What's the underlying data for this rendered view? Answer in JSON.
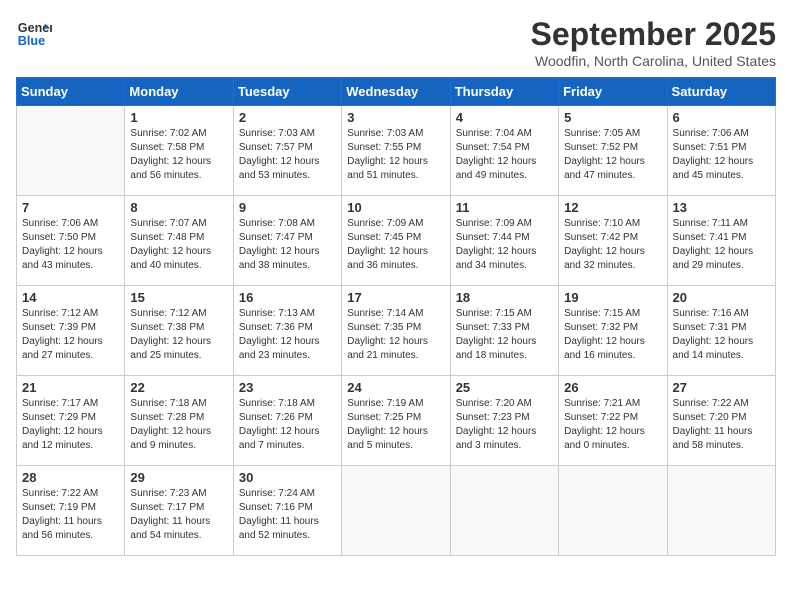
{
  "logo": {
    "line1": "General",
    "line2": "Blue"
  },
  "header": {
    "month_year": "September 2025",
    "location": "Woodfin, North Carolina, United States"
  },
  "days_of_week": [
    "Sunday",
    "Monday",
    "Tuesday",
    "Wednesday",
    "Thursday",
    "Friday",
    "Saturday"
  ],
  "weeks": [
    [
      {
        "day": "",
        "detail": ""
      },
      {
        "day": "1",
        "detail": "Sunrise: 7:02 AM\nSunset: 7:58 PM\nDaylight: 12 hours and 56 minutes."
      },
      {
        "day": "2",
        "detail": "Sunrise: 7:03 AM\nSunset: 7:57 PM\nDaylight: 12 hours and 53 minutes."
      },
      {
        "day": "3",
        "detail": "Sunrise: 7:03 AM\nSunset: 7:55 PM\nDaylight: 12 hours and 51 minutes."
      },
      {
        "day": "4",
        "detail": "Sunrise: 7:04 AM\nSunset: 7:54 PM\nDaylight: 12 hours and 49 minutes."
      },
      {
        "day": "5",
        "detail": "Sunrise: 7:05 AM\nSunset: 7:52 PM\nDaylight: 12 hours and 47 minutes."
      },
      {
        "day": "6",
        "detail": "Sunrise: 7:06 AM\nSunset: 7:51 PM\nDaylight: 12 hours and 45 minutes."
      }
    ],
    [
      {
        "day": "7",
        "detail": "Sunrise: 7:06 AM\nSunset: 7:50 PM\nDaylight: 12 hours and 43 minutes."
      },
      {
        "day": "8",
        "detail": "Sunrise: 7:07 AM\nSunset: 7:48 PM\nDaylight: 12 hours and 40 minutes."
      },
      {
        "day": "9",
        "detail": "Sunrise: 7:08 AM\nSunset: 7:47 PM\nDaylight: 12 hours and 38 minutes."
      },
      {
        "day": "10",
        "detail": "Sunrise: 7:09 AM\nSunset: 7:45 PM\nDaylight: 12 hours and 36 minutes."
      },
      {
        "day": "11",
        "detail": "Sunrise: 7:09 AM\nSunset: 7:44 PM\nDaylight: 12 hours and 34 minutes."
      },
      {
        "day": "12",
        "detail": "Sunrise: 7:10 AM\nSunset: 7:42 PM\nDaylight: 12 hours and 32 minutes."
      },
      {
        "day": "13",
        "detail": "Sunrise: 7:11 AM\nSunset: 7:41 PM\nDaylight: 12 hours and 29 minutes."
      }
    ],
    [
      {
        "day": "14",
        "detail": "Sunrise: 7:12 AM\nSunset: 7:39 PM\nDaylight: 12 hours and 27 minutes."
      },
      {
        "day": "15",
        "detail": "Sunrise: 7:12 AM\nSunset: 7:38 PM\nDaylight: 12 hours and 25 minutes."
      },
      {
        "day": "16",
        "detail": "Sunrise: 7:13 AM\nSunset: 7:36 PM\nDaylight: 12 hours and 23 minutes."
      },
      {
        "day": "17",
        "detail": "Sunrise: 7:14 AM\nSunset: 7:35 PM\nDaylight: 12 hours and 21 minutes."
      },
      {
        "day": "18",
        "detail": "Sunrise: 7:15 AM\nSunset: 7:33 PM\nDaylight: 12 hours and 18 minutes."
      },
      {
        "day": "19",
        "detail": "Sunrise: 7:15 AM\nSunset: 7:32 PM\nDaylight: 12 hours and 16 minutes."
      },
      {
        "day": "20",
        "detail": "Sunrise: 7:16 AM\nSunset: 7:31 PM\nDaylight: 12 hours and 14 minutes."
      }
    ],
    [
      {
        "day": "21",
        "detail": "Sunrise: 7:17 AM\nSunset: 7:29 PM\nDaylight: 12 hours and 12 minutes."
      },
      {
        "day": "22",
        "detail": "Sunrise: 7:18 AM\nSunset: 7:28 PM\nDaylight: 12 hours and 9 minutes."
      },
      {
        "day": "23",
        "detail": "Sunrise: 7:18 AM\nSunset: 7:26 PM\nDaylight: 12 hours and 7 minutes."
      },
      {
        "day": "24",
        "detail": "Sunrise: 7:19 AM\nSunset: 7:25 PM\nDaylight: 12 hours and 5 minutes."
      },
      {
        "day": "25",
        "detail": "Sunrise: 7:20 AM\nSunset: 7:23 PM\nDaylight: 12 hours and 3 minutes."
      },
      {
        "day": "26",
        "detail": "Sunrise: 7:21 AM\nSunset: 7:22 PM\nDaylight: 12 hours and 0 minutes."
      },
      {
        "day": "27",
        "detail": "Sunrise: 7:22 AM\nSunset: 7:20 PM\nDaylight: 11 hours and 58 minutes."
      }
    ],
    [
      {
        "day": "28",
        "detail": "Sunrise: 7:22 AM\nSunset: 7:19 PM\nDaylight: 11 hours and 56 minutes."
      },
      {
        "day": "29",
        "detail": "Sunrise: 7:23 AM\nSunset: 7:17 PM\nDaylight: 11 hours and 54 minutes."
      },
      {
        "day": "30",
        "detail": "Sunrise: 7:24 AM\nSunset: 7:16 PM\nDaylight: 11 hours and 52 minutes."
      },
      {
        "day": "",
        "detail": ""
      },
      {
        "day": "",
        "detail": ""
      },
      {
        "day": "",
        "detail": ""
      },
      {
        "day": "",
        "detail": ""
      }
    ]
  ]
}
